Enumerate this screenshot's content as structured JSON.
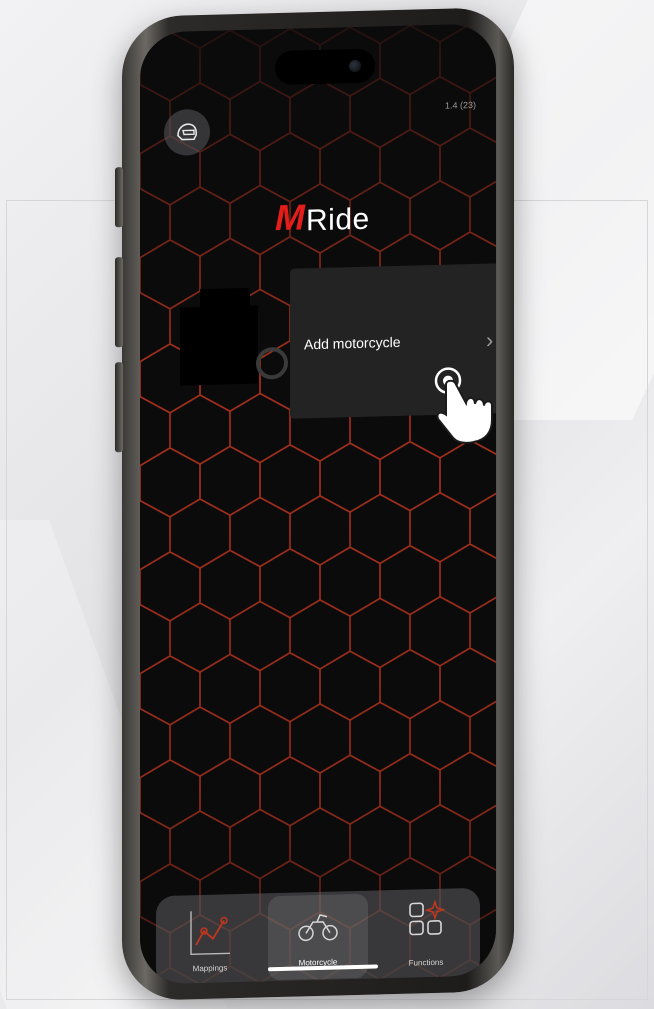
{
  "app": {
    "version": "1.4 (23)",
    "logo": {
      "m": "M",
      "rest": "Ride"
    },
    "brand_red": "#e31d1a",
    "hex_line_color": "#c0361f"
  },
  "header": {
    "profile_button_icon": "helmet-icon"
  },
  "motorcycle_card": {
    "label": "Add motorcycle",
    "chevron": "›",
    "hint_icon": "tap-hand-icon"
  },
  "tabbar": {
    "tabs": [
      {
        "label": "Mappings",
        "icon": "line-chart-icon",
        "selected": false
      },
      {
        "label": "Motorcycle",
        "icon": "motorcycle-icon",
        "selected": true
      },
      {
        "label": "Functions",
        "icon": "function-grid-icon",
        "selected": false
      }
    ]
  }
}
